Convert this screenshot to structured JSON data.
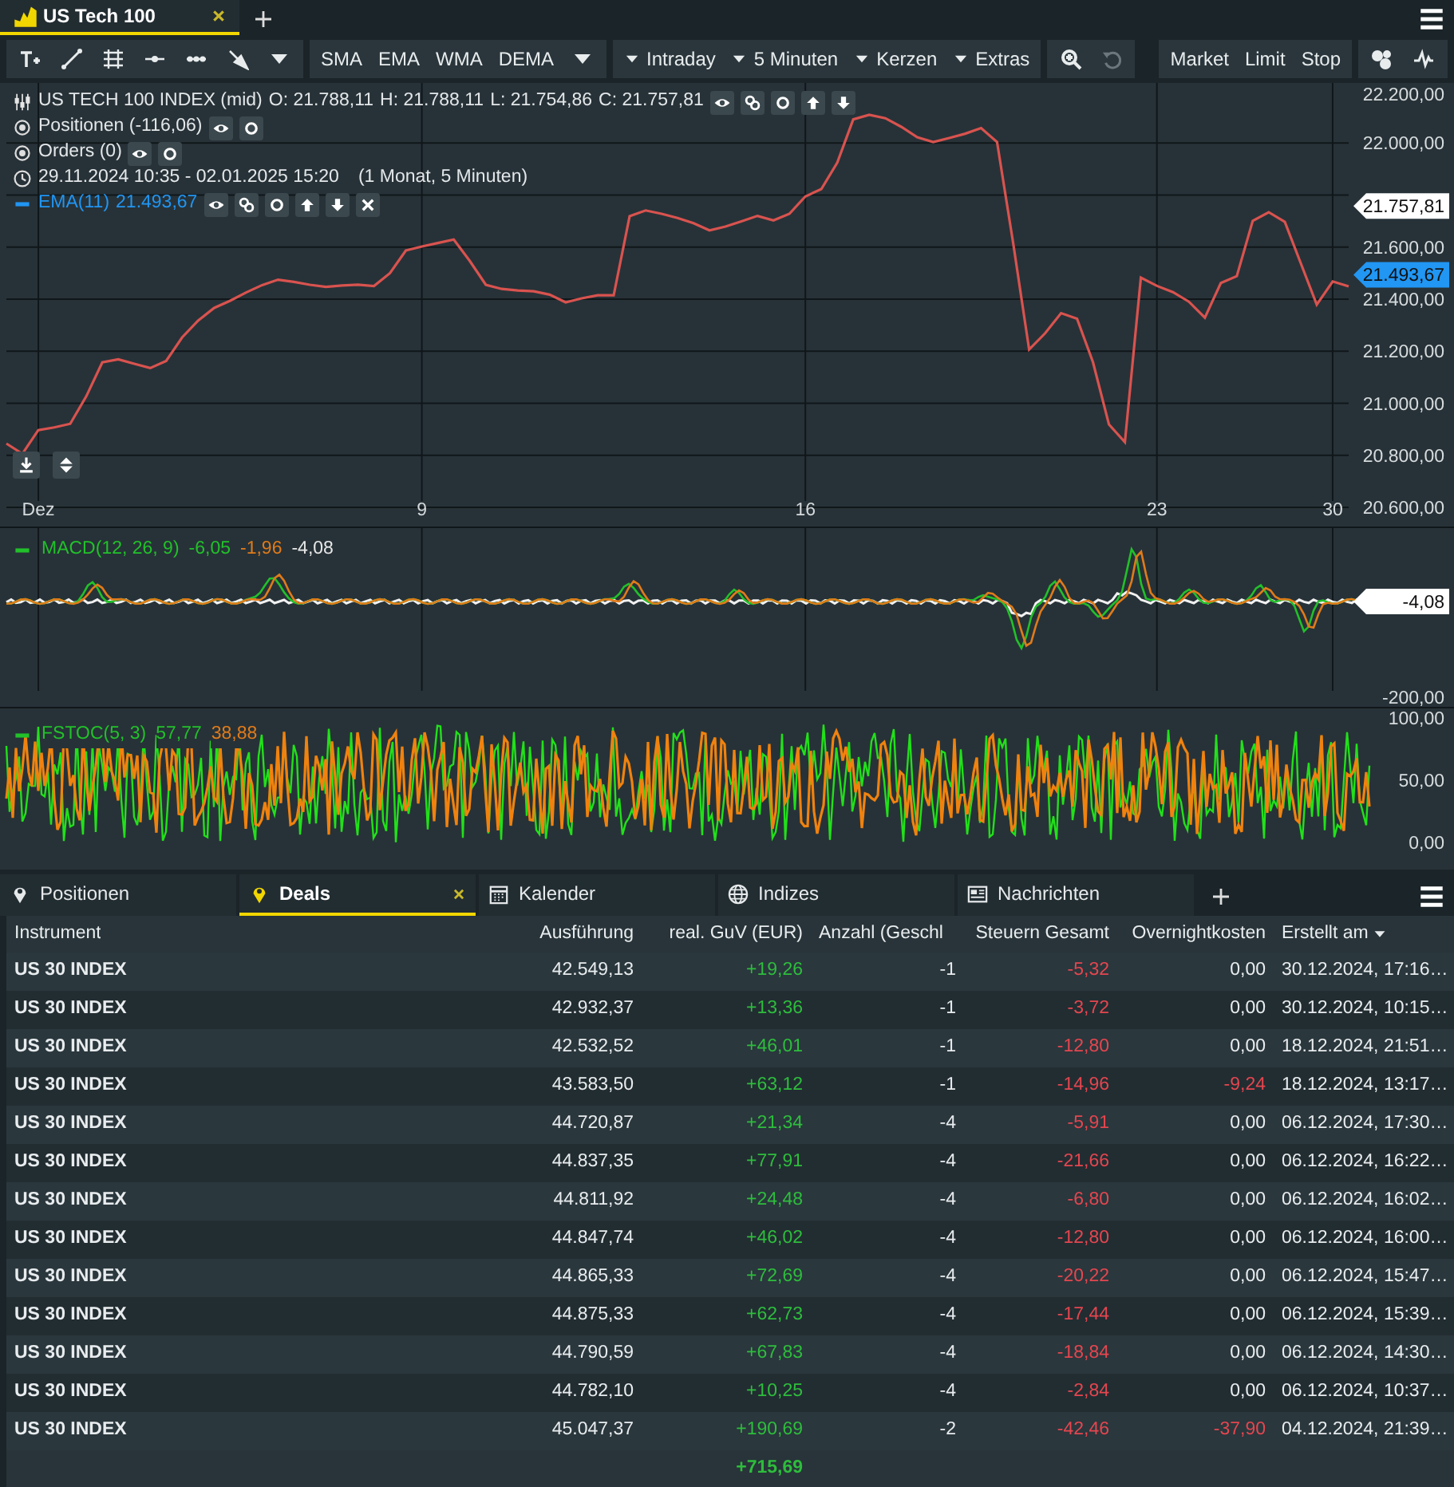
{
  "chart_tab": {
    "title": "US Tech 100",
    "selected": true
  },
  "toolbar": {
    "indicators": [
      "SMA",
      "EMA",
      "WMA",
      "DEMA"
    ],
    "periods": [
      "Intraday",
      "5 Minuten",
      "Kerzen",
      "Extras"
    ],
    "undo": {
      "disabled": true
    },
    "order_types": [
      "Market",
      "Limit",
      "Stop"
    ]
  },
  "legend": {
    "ohlc": [
      "O: 21.788,11",
      "H: 21.788,11",
      "L: 21.754,86",
      "C: 21.757,81"
    ],
    "positions": "Positionen (-116,06)",
    "orders": "Orders (0)",
    "range": "29.11.2024 10:35 - 02.01.2025 15:20",
    "range_note": "(1 Monat, 5 Minuten)",
    "ema": "EMA(11)",
    "ema_value": "21.493,67"
  },
  "price_chart": {
    "chart_data": {
      "type": "line",
      "categories": [
        null,
        null,
        "Dez",
        null,
        null,
        null,
        null,
        null,
        null,
        null,
        null,
        null,
        null,
        null,
        null,
        null,
        null,
        null,
        null,
        null,
        null,
        null,
        null,
        null,
        null,
        null,
        "9",
        null,
        null,
        null,
        null,
        null,
        null,
        null,
        null,
        null,
        null,
        null,
        null,
        null,
        null,
        null,
        null,
        null,
        null,
        null,
        null,
        null,
        null,
        null,
        "16",
        null,
        null,
        null,
        null,
        null,
        null,
        null,
        null,
        null,
        null,
        null,
        null,
        null,
        null,
        null,
        null,
        null,
        null,
        null,
        null,
        null,
        "23",
        null,
        null,
        null,
        null,
        null,
        null,
        null,
        null,
        null,
        null,
        "30",
        null
      ],
      "series": [
        {
          "name": "US TECH 100 INDEX (mid)",
          "color": "#d9534f",
          "values": [
            20845,
            20806,
            20897,
            20907,
            20921,
            21027,
            21157,
            21169,
            21152,
            21135,
            21163,
            21253,
            21317,
            21366,
            21394,
            21426,
            21454,
            21475,
            21466,
            21455,
            21447,
            21453,
            21456,
            21450,
            21500,
            21587,
            21602,
            21616,
            21629,
            21547,
            21455,
            21439,
            21433,
            21430,
            21417,
            21388,
            21403,
            21415,
            21415,
            21719,
            21741,
            21728,
            21712,
            21692,
            21664,
            21679,
            21699,
            21720,
            21703,
            21728,
            21795,
            21823,
            21925,
            22091,
            22108,
            22095,
            22062,
            22022,
            22004,
            22019,
            22036,
            22057,
            22004,
            21615,
            21206,
            21269,
            21346,
            21325,
            21158,
            20919,
            20851,
            21483,
            21451,
            21427,
            21390,
            21329,
            21462,
            21488,
            21701,
            21734,
            21697,
            21538,
            21379,
            21468,
            21449
          ]
        }
      ],
      "ylim": [
        20600,
        22200
      ],
      "yticks": [
        {
          "value": 20600,
          "label": "20.600,00"
        },
        {
          "value": 20800,
          "label": "20.800,00"
        },
        {
          "value": 21000,
          "label": "21.000,00"
        },
        {
          "value": 21200,
          "label": "21.200,00"
        },
        {
          "value": 21400,
          "label": "21.400,00"
        },
        {
          "value": 21600,
          "label": "21.600,00"
        },
        {
          "value": 22000,
          "label": "22.000,00"
        },
        {
          "value": 22200,
          "label": "22.200,00"
        }
      ],
      "grid": true
    },
    "price_tags": [
      {
        "text": "21.757,81",
        "color": "#ffffff"
      },
      {
        "text": "21.493,67",
        "color": "#2196f3"
      }
    ]
  },
  "macd": {
    "name": "MACD(12, 26, 9)",
    "values": [
      {
        "text": "-6,05",
        "color": "#22c02a"
      },
      {
        "text": "-1,96",
        "color": "#e07b1a"
      },
      {
        "text": "-4,08",
        "color": "#e6e6e6"
      }
    ],
    "tick": "-200,00",
    "tag": "-4,08"
  },
  "fstoc": {
    "name": "FSTOC(5, 3)",
    "values": [
      {
        "text": "57,77",
        "color": "#22c02a"
      },
      {
        "text": "38,88",
        "color": "#e07b1a"
      }
    ],
    "ticks": [
      "100,00",
      "50,00",
      "0,00"
    ]
  },
  "bottom_tabs": [
    {
      "label": "Positionen",
      "selected": false,
      "closable": false
    },
    {
      "label": "Deals",
      "selected": true,
      "closable": true
    },
    {
      "label": "Kalender",
      "selected": false,
      "closable": false
    },
    {
      "label": "Indizes",
      "selected": false,
      "closable": false
    },
    {
      "label": "Nachrichten",
      "selected": false,
      "closable": false
    }
  ],
  "table": {
    "columns": [
      {
        "label": "Instrument",
        "sorted": false
      },
      {
        "label": "Ausführung",
        "sorted": false
      },
      {
        "label": "real. GuV (EUR)",
        "sorted": false
      },
      {
        "label": "Anzahl (Geschl",
        "sorted": false
      },
      {
        "label": "Steuern Gesamt",
        "sorted": false
      },
      {
        "label": "Overnightkosten",
        "sorted": false
      },
      {
        "label": "Erstellt am",
        "sorted": true
      }
    ],
    "rows": [
      {
        "instrument": "US 30 INDEX",
        "execution": "42.549,13",
        "pnl": "+19,26",
        "quantity": "-1",
        "taxes": "-5,32",
        "overnight": "0,00",
        "overnight_charged": false,
        "created": "30.12.2024, 17:16…"
      },
      {
        "instrument": "US 30 INDEX",
        "execution": "42.932,37",
        "pnl": "+13,36",
        "quantity": "-1",
        "taxes": "-3,72",
        "overnight": "0,00",
        "overnight_charged": false,
        "created": "30.12.2024, 10:15…"
      },
      {
        "instrument": "US 30 INDEX",
        "execution": "42.532,52",
        "pnl": "+46,01",
        "quantity": "-1",
        "taxes": "-12,80",
        "overnight": "0,00",
        "overnight_charged": false,
        "created": "18.12.2024, 21:51…"
      },
      {
        "instrument": "US 30 INDEX",
        "execution": "43.583,50",
        "pnl": "+63,12",
        "quantity": "-1",
        "taxes": "-14,96",
        "overnight": "-9,24",
        "overnight_charged": true,
        "created": "18.12.2024, 13:17…"
      },
      {
        "instrument": "US 30 INDEX",
        "execution": "44.720,87",
        "pnl": "+21,34",
        "quantity": "-4",
        "taxes": "-5,91",
        "overnight": "0,00",
        "overnight_charged": false,
        "created": "06.12.2024, 17:30…"
      },
      {
        "instrument": "US 30 INDEX",
        "execution": "44.837,35",
        "pnl": "+77,91",
        "quantity": "-4",
        "taxes": "-21,66",
        "overnight": "0,00",
        "overnight_charged": false,
        "created": "06.12.2024, 16:22…"
      },
      {
        "instrument": "US 30 INDEX",
        "execution": "44.811,92",
        "pnl": "+24,48",
        "quantity": "-4",
        "taxes": "-6,80",
        "overnight": "0,00",
        "overnight_charged": false,
        "created": "06.12.2024, 16:02…"
      },
      {
        "instrument": "US 30 INDEX",
        "execution": "44.847,74",
        "pnl": "+46,02",
        "quantity": "-4",
        "taxes": "-12,80",
        "overnight": "0,00",
        "overnight_charged": false,
        "created": "06.12.2024, 16:00…"
      },
      {
        "instrument": "US 30 INDEX",
        "execution": "44.865,33",
        "pnl": "+72,69",
        "quantity": "-4",
        "taxes": "-20,22",
        "overnight": "0,00",
        "overnight_charged": false,
        "created": "06.12.2024, 15:47…"
      },
      {
        "instrument": "US 30 INDEX",
        "execution": "44.875,33",
        "pnl": "+62,73",
        "quantity": "-4",
        "taxes": "-17,44",
        "overnight": "0,00",
        "overnight_charged": false,
        "created": "06.12.2024, 15:39…"
      },
      {
        "instrument": "US 30 INDEX",
        "execution": "44.790,59",
        "pnl": "+67,83",
        "quantity": "-4",
        "taxes": "-18,84",
        "overnight": "0,00",
        "overnight_charged": false,
        "created": "06.12.2024, 14:30…"
      },
      {
        "instrument": "US 30 INDEX",
        "execution": "44.782,10",
        "pnl": "+10,25",
        "quantity": "-4",
        "taxes": "-2,84",
        "overnight": "0,00",
        "overnight_charged": false,
        "created": "06.12.2024, 10:37…"
      },
      {
        "instrument": "US 30 INDEX",
        "execution": "45.047,37",
        "pnl": "+190,69",
        "quantity": "-2",
        "taxes": "-42,46",
        "overnight": "-37,90",
        "overnight_charged": true,
        "created": "04.12.2024, 21:39…"
      }
    ],
    "total": "+715,69"
  }
}
